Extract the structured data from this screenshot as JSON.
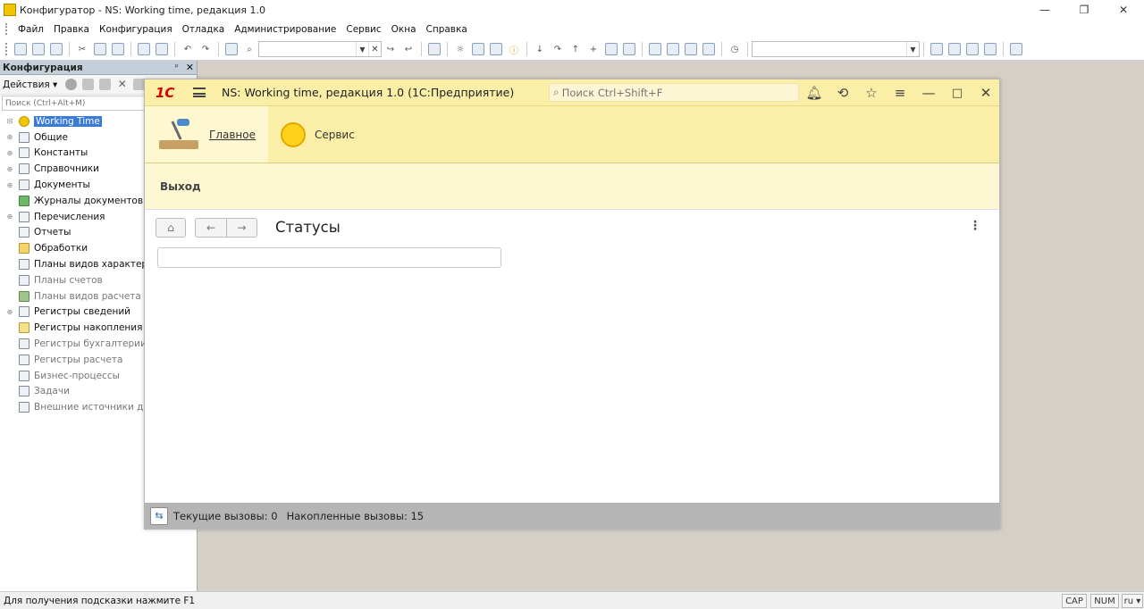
{
  "window": {
    "title": "Конфигуратор - NS: Working time, редакция 1.0",
    "controls": {
      "minimize": "—",
      "restore": "❐",
      "close": "✕"
    }
  },
  "menu": [
    "Файл",
    "Правка",
    "Конфигурация",
    "Отладка",
    "Администрирование",
    "Сервис",
    "Окна",
    "Справка"
  ],
  "toolbar": {
    "combo1_value": "",
    "combo2_value": "",
    "combo_clear": "✕"
  },
  "config_panel": {
    "title": "Конфигурация",
    "pin": "ᵖ",
    "close": "✕",
    "actions_label": "Действия ▾",
    "search_placeholder": "Поиск (Ctrl+Alt+M)",
    "tree": [
      {
        "label": "Working Time",
        "icon": "config-root-icon"
      },
      {
        "label": "Общие",
        "icon": "common-icon"
      },
      {
        "label": "Константы",
        "icon": "constants-icon"
      },
      {
        "label": "Справочники",
        "icon": "catalogs-icon"
      },
      {
        "label": "Документы",
        "icon": "documents-icon"
      },
      {
        "label": "Журналы документов",
        "icon": "journals-icon"
      },
      {
        "label": "Перечисления",
        "icon": "enums-icon"
      },
      {
        "label": "Отчеты",
        "icon": "reports-icon"
      },
      {
        "label": "Обработки",
        "icon": "processings-icon"
      },
      {
        "label": "Планы видов характеристик",
        "icon": "chart-of-characteristics-icon"
      },
      {
        "label": "Планы счетов",
        "icon": "chart-of-accounts-icon"
      },
      {
        "label": "Планы видов расчета",
        "icon": "chart-of-calculation-icon"
      },
      {
        "label": "Регистры сведений",
        "icon": "info-registers-icon"
      },
      {
        "label": "Регистры накопления",
        "icon": "accumulation-registers-icon"
      },
      {
        "label": "Регистры бухгалтерии",
        "icon": "accounting-registers-icon"
      },
      {
        "label": "Регистры расчета",
        "icon": "calculation-registers-icon"
      },
      {
        "label": "Бизнес-процессы",
        "icon": "business-processes-icon"
      },
      {
        "label": "Задачи",
        "icon": "tasks-icon"
      },
      {
        "label": "Внешние источники данных",
        "icon": "external-sources-icon"
      }
    ]
  },
  "app": {
    "logo": "1С",
    "title": "NS: Working time, редакция 1.0  (1С:Предприятие)",
    "search_placeholder": "Поиск Ctrl+Shift+F",
    "sections": [
      {
        "label": "Главное",
        "active": true,
        "icon": "desk-lamp-icon"
      },
      {
        "label": "Сервис",
        "active": false,
        "icon": "sun-icon"
      }
    ],
    "command": "Выход",
    "form_title": "Статусы",
    "form_input_value": "",
    "status": {
      "current_calls": "Текущие вызовы: 0",
      "accumulated_calls": "Накопленные вызовы: 15"
    }
  },
  "statusbar": {
    "hint": "Для получения подсказки нажмите F1",
    "cap": "CAP",
    "num": "NUM",
    "lang": "ru ▾"
  },
  "colors": {
    "app_header_bg": "#fbeea7",
    "tree_selection": "#3b7bd4",
    "logo_red": "#d40000"
  }
}
